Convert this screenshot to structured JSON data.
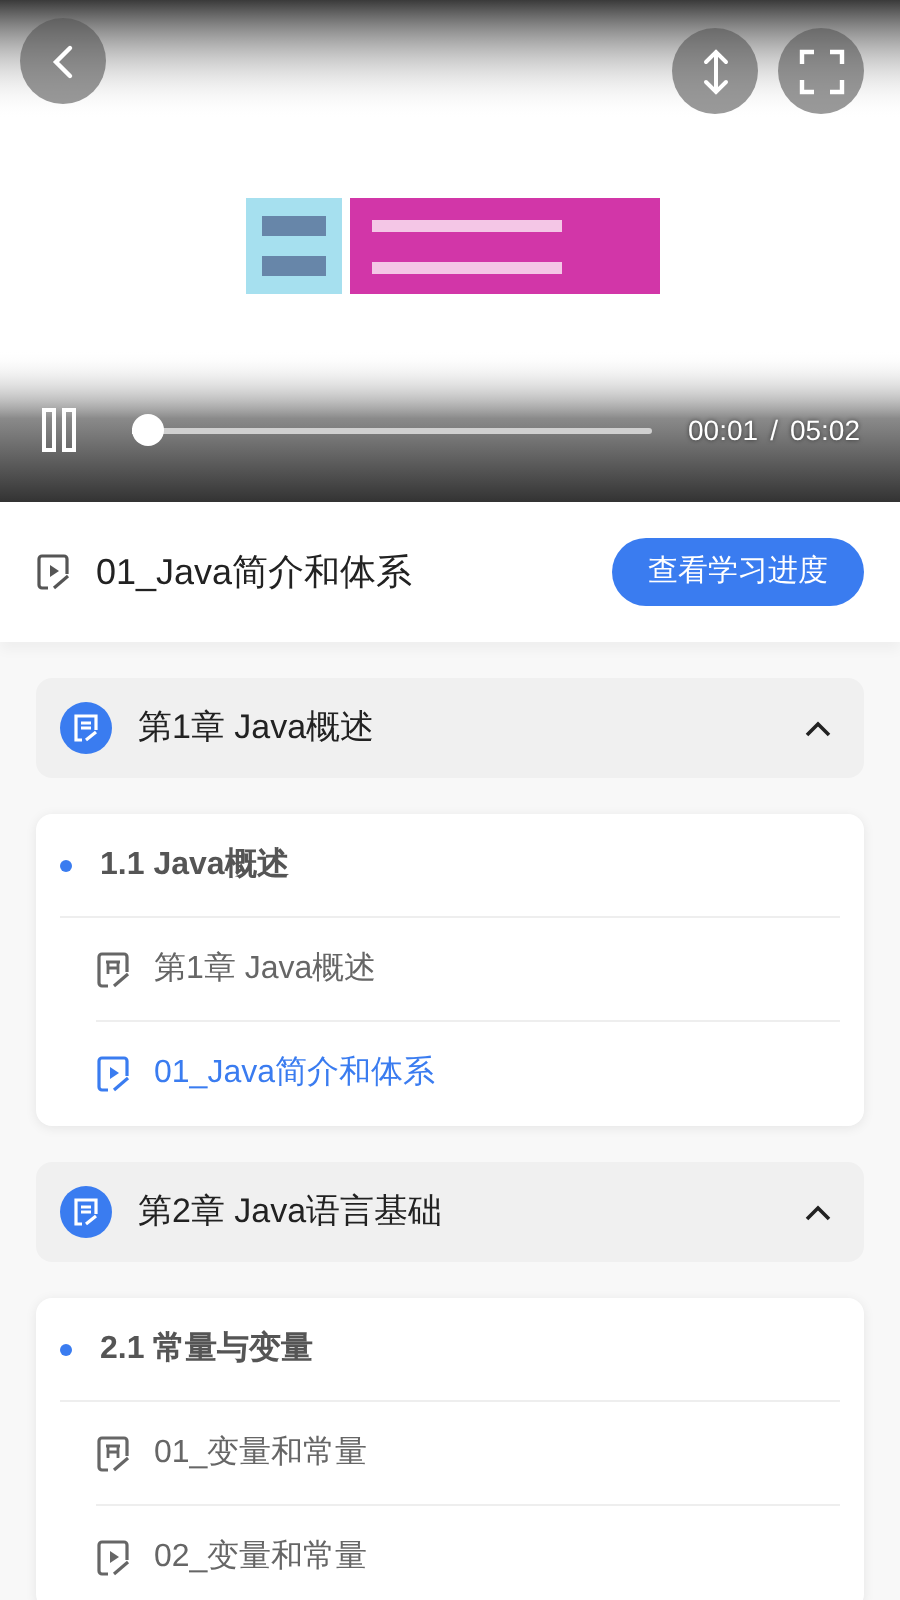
{
  "player": {
    "playing": true,
    "level": 0.03,
    "time_current": "00:01",
    "time_separator": "/",
    "time_total": "05:02"
  },
  "current_lesson": {
    "title": "01_Java简介和体系"
  },
  "progress_button": "查看学习进度",
  "chapters": [
    {
      "title": "第1章 Java概述",
      "expanded": true,
      "sections": [
        {
          "title": "1.1 Java概述",
          "lessons": [
            {
              "kind": "document",
              "title": "第1章 Java概述",
              "selected": false
            },
            {
              "kind": "video",
              "title": "01_Java简介和体系",
              "selected": true
            }
          ]
        }
      ]
    },
    {
      "title": "第2章 Java语言基础",
      "expanded": true,
      "sections": [
        {
          "title": "2.1 常量与变量",
          "lessons": [
            {
              "kind": "document",
              "title": "01_变量和常量",
              "selected": false
            },
            {
              "kind": "video",
              "title": "02_变量和常量",
              "selected": false
            }
          ]
        }
      ]
    }
  ]
}
